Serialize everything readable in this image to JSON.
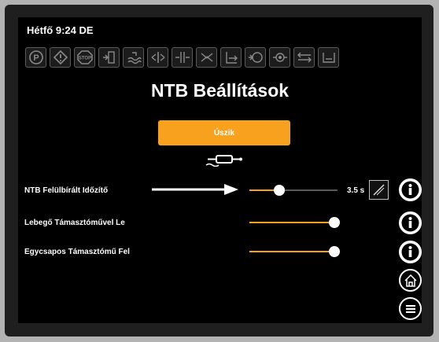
{
  "status": {
    "day": "Hétfő",
    "time": "9:24 DE"
  },
  "icon_bar": [
    "parking-brake-icon",
    "warning-icon",
    "stop-icon",
    "mast-tilt-icon",
    "water-level-icon",
    "side-shift-icon",
    "fork-spread-icon",
    "fork-position-icon",
    "forward-reach-icon",
    "valve-icon",
    "sensor-icon",
    "float-icon",
    "bucket-icon"
  ],
  "page": {
    "title": "NTB Beállítások"
  },
  "mode_button": {
    "label": "Úszik"
  },
  "settings": [
    {
      "label": "NTB Felülbírált Időzítő",
      "level_percent": 34,
      "value": "3.5 s"
    },
    {
      "label": "Lebegő Támasztóművel Le",
      "level_percent": 100
    },
    {
      "label": "Egycsapos Támasztómű Fel",
      "level_percent": 100
    }
  ],
  "colors": {
    "accent": "#f7a11e",
    "background": "#000000",
    "text": "#ffffff",
    "bezel": "#1f1f1f"
  }
}
